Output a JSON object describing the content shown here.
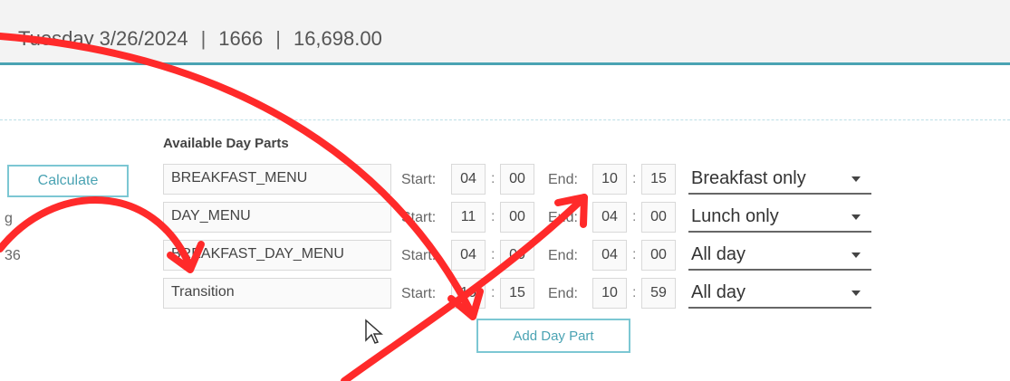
{
  "header": {
    "date": "Tuesday 3/26/2024",
    "count": "1666",
    "amount": "16,698.00"
  },
  "left_panel": {
    "calculate_label": "Calculate",
    "fragment_1": "g",
    "fragment_2": "36"
  },
  "day_parts": {
    "title": "Available Day Parts",
    "start_label": "Start:",
    "end_label": "End:",
    "rows": [
      {
        "name": "BREAKFAST_MENU",
        "start_h": "04",
        "start_m": "00",
        "end_h": "10",
        "end_m": "15",
        "mode": "Breakfast only"
      },
      {
        "name": "DAY_MENU",
        "start_h": "11",
        "start_m": "00",
        "end_h": "04",
        "end_m": "00",
        "mode": "Lunch only"
      },
      {
        "name": "BREAKFAST_DAY_MENU",
        "start_h": "04",
        "start_m": "00",
        "end_h": "04",
        "end_m": "00",
        "mode": "All day"
      },
      {
        "name": "Transition",
        "start_h": "10",
        "start_m": "15",
        "end_h": "10",
        "end_m": "59",
        "mode": "All day"
      }
    ],
    "add_label": "Add Day Part"
  },
  "colors": {
    "accent": "#4aa3b3",
    "annotation": "#ff2a2a"
  }
}
